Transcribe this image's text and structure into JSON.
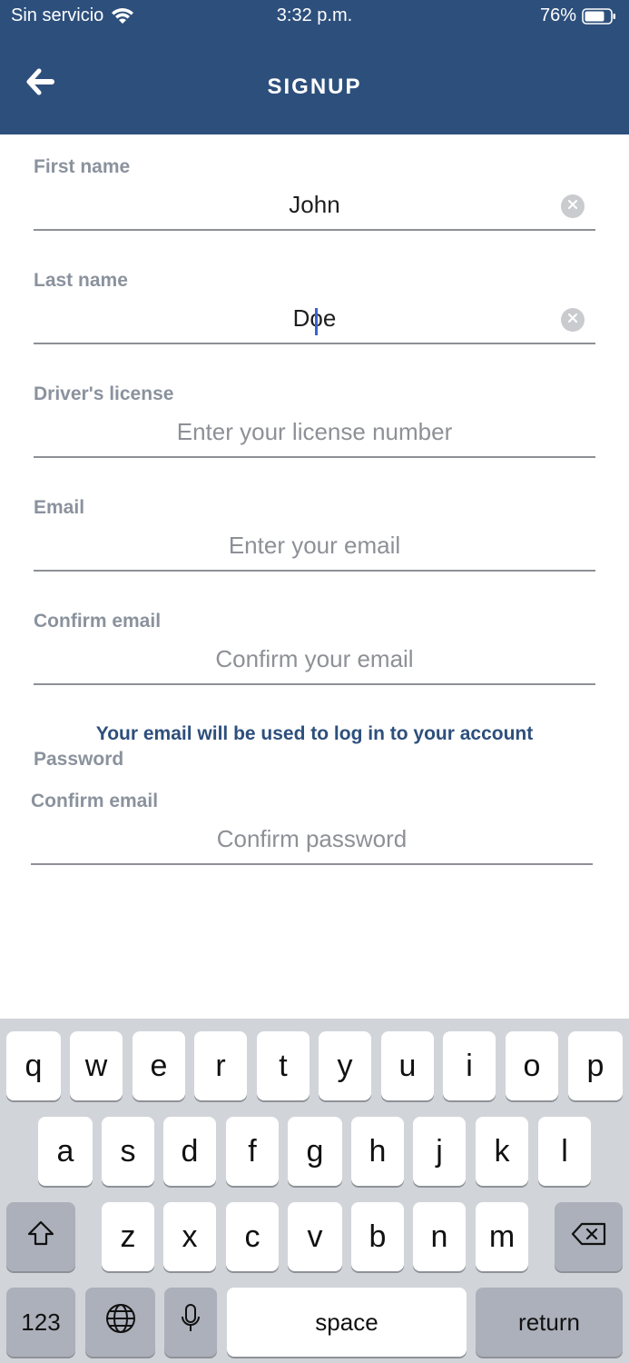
{
  "status_bar": {
    "carrier": "Sin servicio",
    "time": "3:32 p.m.",
    "battery": "76%"
  },
  "header": {
    "title": "SIGNUP"
  },
  "form": {
    "first_name": {
      "label": "First name",
      "value": "John"
    },
    "last_name": {
      "label": "Last name",
      "value": "Doe"
    },
    "license": {
      "label": "Driver's license",
      "placeholder": "Enter your license number"
    },
    "email": {
      "label": "Email",
      "placeholder": "Enter your email"
    },
    "confirm_email": {
      "label": "Confirm email",
      "placeholder": "Confirm your email"
    },
    "email_note": "Your email will be used to log in to your account",
    "password_label": "Password",
    "confirm_password": {
      "label": "Confirm email",
      "placeholder": "Confirm password"
    }
  },
  "keyboard": {
    "row1": [
      "q",
      "w",
      "e",
      "r",
      "t",
      "y",
      "u",
      "i",
      "o",
      "p"
    ],
    "row2": [
      "a",
      "s",
      "d",
      "f",
      "g",
      "h",
      "j",
      "k",
      "l"
    ],
    "row3": [
      "z",
      "x",
      "c",
      "v",
      "b",
      "n",
      "m"
    ],
    "numbers_label": "123",
    "space_label": "space",
    "return_label": "return"
  },
  "colors": {
    "header_bg": "#2d4f7c",
    "label": "#8a929d",
    "accent_text": "#2d4f7c",
    "keyboard_bg": "#d1d4d9"
  }
}
